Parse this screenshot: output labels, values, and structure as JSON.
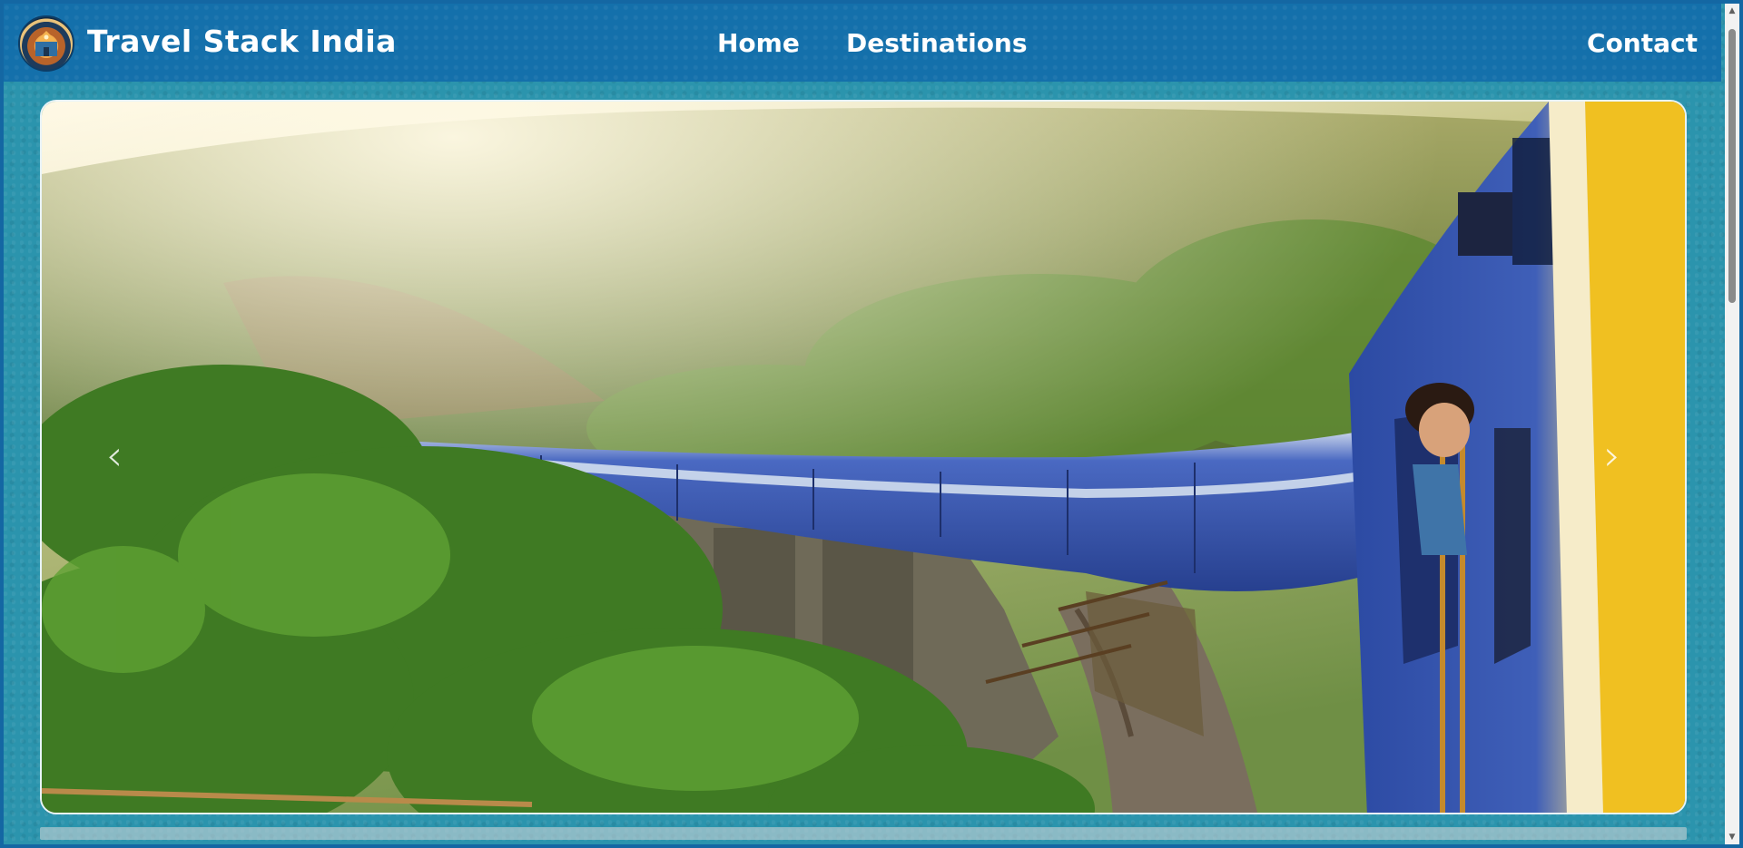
{
  "header": {
    "brand": "Travel Stack India",
    "logo_icon": "temple-emblem-icon",
    "nav": {
      "home": "Home",
      "destinations": "Destinations",
      "contact": "Contact"
    }
  },
  "hero": {
    "prev_icon": "chevron-left-icon",
    "next_icon": "chevron-right-icon",
    "prev_glyph": "‹",
    "next_glyph": "›"
  },
  "colors": {
    "navbar": "#1470ab",
    "page_background": "#2b94ad",
    "text": "#ffffff"
  }
}
